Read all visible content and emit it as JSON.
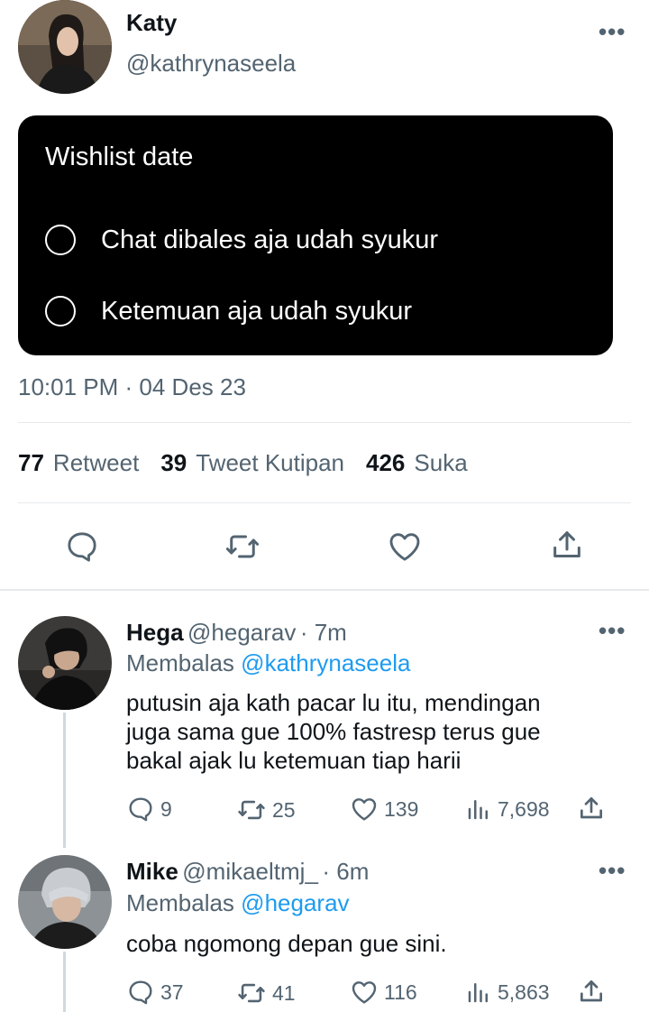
{
  "tweet": {
    "author_name": "Katy",
    "author_handle": "@kathrynaseela",
    "more_label": "•••",
    "poll": {
      "title": "Wishlist date",
      "options": [
        "Chat dibales aja udah syukur",
        "Ketemuan aja udah syukur"
      ]
    },
    "timestamp": "10:01 PM · 04 Des 23",
    "stats": [
      {
        "count": "77",
        "label": "Retweet"
      },
      {
        "count": "39",
        "label": "Tweet Kutipan"
      },
      {
        "count": "426",
        "label": "Suka"
      }
    ]
  },
  "replies": [
    {
      "name": "Hega",
      "handle": "@hegarav",
      "time": "· 7m",
      "replying_prefix": "Membalas",
      "replying_to": "@kathrynaseela",
      "text_lines": [
        "putusin aja kath pacar lu itu, mendingan",
        "juga sama gue 100% fastresp terus gue",
        "bakal ajak lu ketemuan tiap harii"
      ],
      "replies": "9",
      "retweets": "25",
      "likes": "139",
      "views": "7,698"
    },
    {
      "name": "Mike",
      "handle": "@mikaeltmj_",
      "time": "· 6m",
      "replying_prefix": "Membalas",
      "replying_to": "@hegarav",
      "text_lines": [
        "coba ngomong depan gue sini."
      ],
      "replies": "37",
      "retweets": "41",
      "likes": "116",
      "views": "5,863"
    }
  ],
  "icons": {
    "reply": "reply-icon",
    "retweet": "retweet-icon",
    "like": "heart-icon",
    "views": "views-icon",
    "share": "share-icon",
    "more": "more-icon"
  },
  "colors": {
    "text": "#0f1419",
    "muted": "#536471",
    "link": "#1d9bf0",
    "poll_bg": "#000000"
  }
}
